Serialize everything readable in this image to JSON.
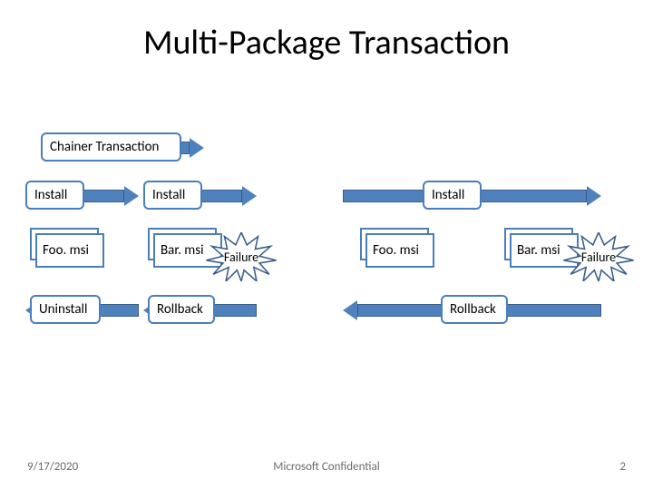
{
  "title": "Multi-Package Transaction",
  "labels": {
    "chainer": "Chainer Transaction",
    "install": "Install",
    "uninstall": "Uninstall",
    "rollback": "Rollback",
    "failure": "Failure"
  },
  "packages": {
    "foo": "Foo. msi",
    "bar": "Bar. msi"
  },
  "footer": {
    "date": "9/17/2020",
    "confidential": "Microsoft Confidential",
    "page": "2"
  },
  "colors": {
    "accent": "#4f81bd",
    "border": "#385d8a"
  }
}
